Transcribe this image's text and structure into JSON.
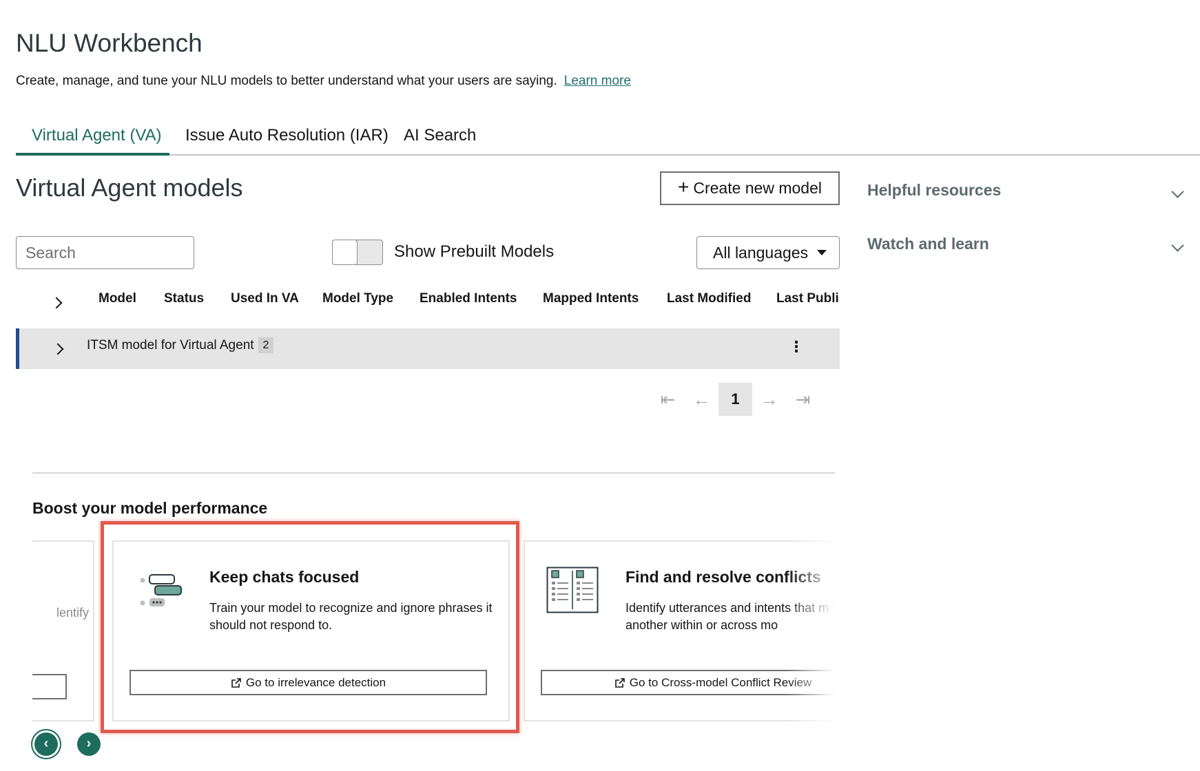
{
  "page": {
    "title": "NLU Workbench",
    "subtitle": "Create, manage, and tune your NLU models to better understand what your users are saying.",
    "learn_more": "Learn more"
  },
  "tabs": [
    {
      "label": "Virtual Agent (VA)",
      "active": true
    },
    {
      "label": "Issue Auto Resolution (IAR)",
      "active": false
    },
    {
      "label": "AI Search",
      "active": false
    }
  ],
  "models": {
    "title": "Virtual Agent models",
    "create_button": "Create new model",
    "search_placeholder": "Search",
    "toggle_label": "Show Prebuilt Models",
    "toggle_on": false,
    "language_select": "All languages",
    "columns": [
      "Model",
      "Status",
      "Used In VA",
      "Model Type",
      "Enabled Intents",
      "Mapped Intents",
      "Last Modified",
      "Last Publis"
    ],
    "rows": [
      {
        "name": "ITSM model for Virtual Agent",
        "badge": "2"
      }
    ],
    "pagination": {
      "current_page": "1"
    }
  },
  "boost": {
    "title": "Boost your model performance",
    "partial_left_text": "lentify",
    "cards": [
      {
        "title": "Keep chats focused",
        "description": "Train your model to recognize and ignore phrases it should not respond to.",
        "button": "Go to irrelevance detection",
        "icon": "chat-bubbles-icon"
      },
      {
        "title": "Find and resolve conflicts",
        "description": "Identify utterances and intents that m with one another within or across mo",
        "button": "Go to Cross-model Conflict Review",
        "icon": "document-grid-icon"
      }
    ]
  },
  "sidebar": {
    "items": [
      {
        "label": "Helpful resources"
      },
      {
        "label": "Watch and learn"
      }
    ]
  },
  "colors": {
    "accent": "#1e6c5e",
    "row_marker": "#1f4e8c",
    "highlight": "#e05a4f"
  }
}
